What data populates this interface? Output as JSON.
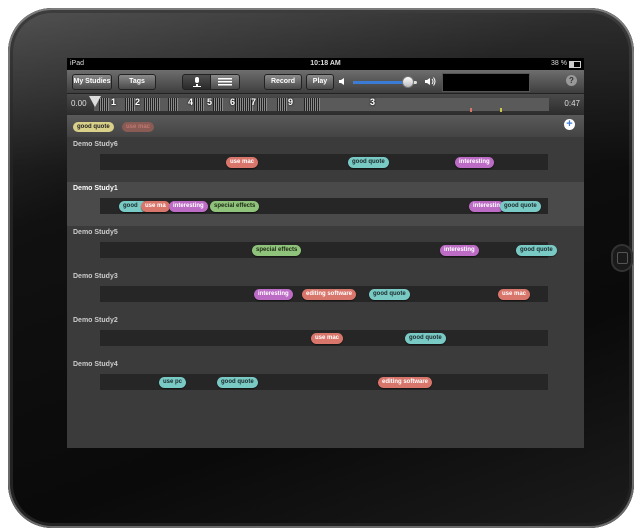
{
  "status_bar": {
    "carrier": "iPad",
    "time": "10:18 AM",
    "battery": "38 %"
  },
  "toolbar": {
    "my_studies_label": "My Studies",
    "tags_label": "Tags",
    "record_label": "Record",
    "play_label": "Play",
    "help_label": "?",
    "volume": 0.85
  },
  "timeline": {
    "start_time": "0.00",
    "end_time": "0:47",
    "markers": [
      "1",
      "2",
      "4",
      "5",
      "6",
      "7",
      "9",
      "3"
    ]
  },
  "filter": {
    "tags": [
      {
        "label": "good quote",
        "active": true
      },
      {
        "label": "use mac",
        "active": false
      }
    ],
    "add_label": "+"
  },
  "studies": [
    {
      "name": "Demo Study6",
      "selected": false,
      "tags": [
        {
          "label": "use mac",
          "color": "red"
        },
        {
          "label": "good quote",
          "color": "teal"
        },
        {
          "label": "interesting",
          "color": "purple"
        }
      ]
    },
    {
      "name": "Demo Study1",
      "selected": true,
      "tags": [
        {
          "label": "good",
          "color": "teal"
        },
        {
          "label": "use ma",
          "color": "red"
        },
        {
          "label": "interesting",
          "color": "purple"
        },
        {
          "label": "special effects",
          "color": "green"
        },
        {
          "label": "interestin",
          "color": "purple"
        },
        {
          "label": "good quote",
          "color": "teal"
        }
      ]
    },
    {
      "name": "Demo Study5",
      "selected": false,
      "tags": [
        {
          "label": "special effects",
          "color": "green"
        },
        {
          "label": "interesting",
          "color": "purple"
        },
        {
          "label": "good quote",
          "color": "teal"
        }
      ]
    },
    {
      "name": "Demo Study3",
      "selected": false,
      "tags": [
        {
          "label": "interesting",
          "color": "purple"
        },
        {
          "label": "editing software",
          "color": "red"
        },
        {
          "label": "good quote",
          "color": "teal"
        },
        {
          "label": "use mac",
          "color": "red"
        }
      ]
    },
    {
      "name": "Demo Study2",
      "selected": false,
      "tags": [
        {
          "label": "use mac",
          "color": "red"
        },
        {
          "label": "good quote",
          "color": "teal"
        }
      ]
    },
    {
      "name": "Demo Study4",
      "selected": false,
      "tags": [
        {
          "label": "use pc",
          "color": "teal"
        },
        {
          "label": "good quote",
          "color": "teal"
        },
        {
          "label": "editing software",
          "color": "red"
        }
      ]
    }
  ],
  "colors": {
    "red": "#d9766b",
    "teal": "#79c9c5",
    "purple": "#bd6cc6",
    "green": "#8fc27a",
    "filter_active": "#d9d08a"
  }
}
